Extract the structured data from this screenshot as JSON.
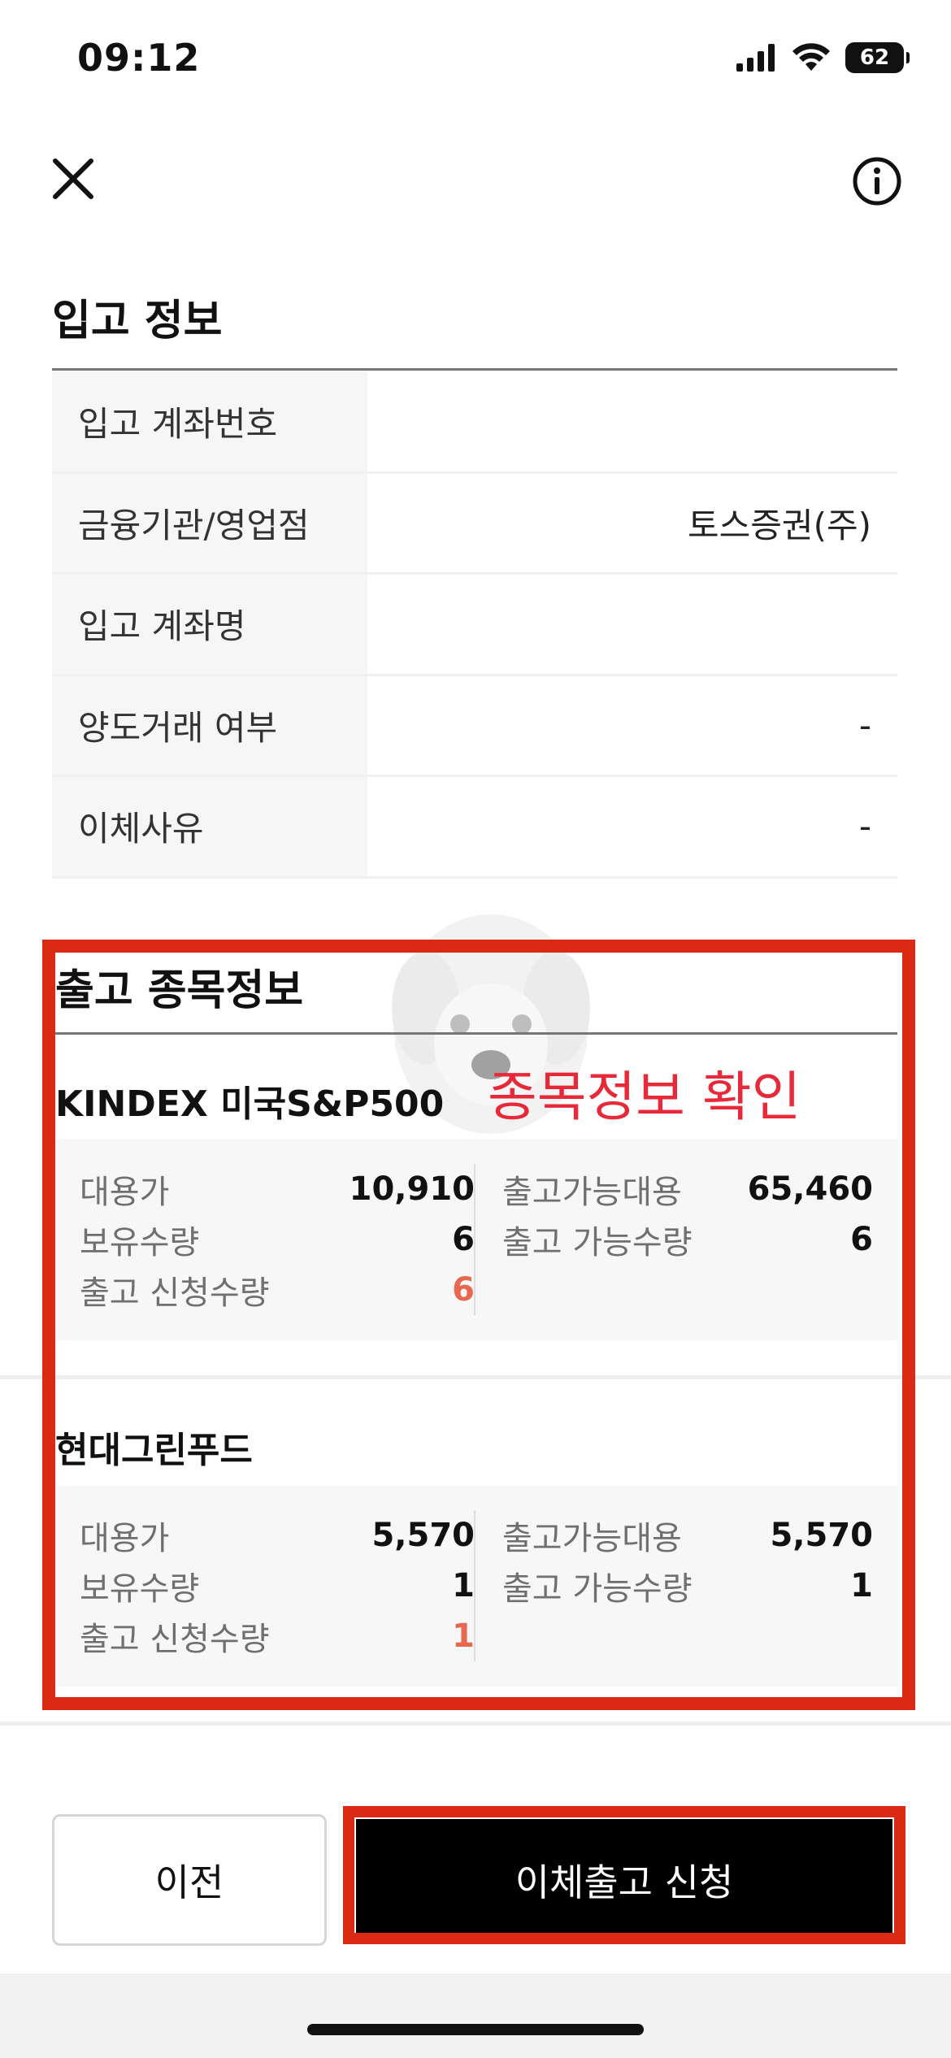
{
  "status_bar": {
    "time": "09:12",
    "battery": "62"
  },
  "nav": {
    "close_icon": "close-icon",
    "info_icon": "info-icon"
  },
  "deposit_info": {
    "title": "입고 정보",
    "rows": [
      {
        "label": "입고 계좌번호",
        "value": ""
      },
      {
        "label": "금융기관/영업점",
        "value": "토스증권(주)"
      },
      {
        "label": "입고 계좌명",
        "value": ""
      },
      {
        "label": "양도거래 여부",
        "value": "-"
      },
      {
        "label": "이체사유",
        "value": "-"
      }
    ]
  },
  "withdraw_items": {
    "title": "출고 종목정보",
    "overlay_label": "종목정보 확인",
    "stocks": [
      {
        "name": "KINDEX 미국S&P500",
        "left": [
          {
            "label": "대용가",
            "value": "10,910"
          },
          {
            "label": "보유수량",
            "value": "6"
          },
          {
            "label": "출고 신청수량",
            "value": "6"
          }
        ],
        "right": [
          {
            "label": "출고가능대용",
            "value": "65,460"
          },
          {
            "label": "출고 가능수량",
            "value": "6"
          }
        ]
      },
      {
        "name": "현대그린푸드",
        "left": [
          {
            "label": "대용가",
            "value": "5,570"
          },
          {
            "label": "보유수량",
            "value": "1"
          },
          {
            "label": "출고 신청수량",
            "value": "1"
          }
        ],
        "right": [
          {
            "label": "출고가능대용",
            "value": "5,570"
          },
          {
            "label": "출고 가능수량",
            "value": "1"
          }
        ]
      }
    ]
  },
  "buttons": {
    "prev": "이전",
    "submit": "이체출고 신청"
  },
  "colors": {
    "highlight": "#db2a14",
    "accent_red": "#e8684f",
    "overlay_text": "#e8293a"
  }
}
